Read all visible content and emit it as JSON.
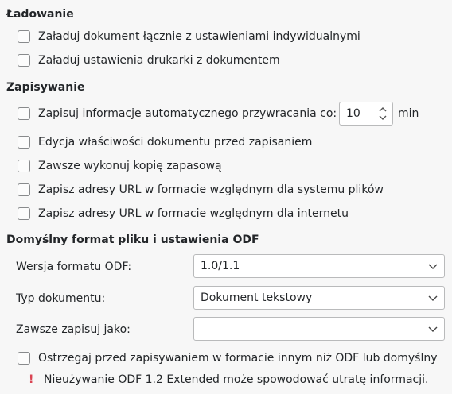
{
  "loading": {
    "title": "Ładowanie",
    "items": [
      {
        "label": "Załaduj dokument łącznie z ustawieniami indywidualnymi",
        "checked": false
      },
      {
        "label": "Załaduj ustawienia drukarki z dokumentem",
        "checked": false
      }
    ]
  },
  "saving": {
    "title": "Zapisywanie",
    "autorecovery": {
      "label": "Zapisuj informacje automatycznego przywracania co:",
      "checked": false,
      "value": "10",
      "unit": "min"
    },
    "items": [
      {
        "label": "Edycja właściwości dokumentu przed zapisaniem",
        "checked": false
      },
      {
        "label": "Zawsze wykonuj kopię zapasową",
        "checked": false
      },
      {
        "label": "Zapisz adresy URL w formacie względnym dla systemu plików",
        "checked": false
      },
      {
        "label": "Zapisz adresy URL w formacie względnym dla internetu",
        "checked": false
      }
    ]
  },
  "odf": {
    "title": "Domyślny format pliku i ustawienia ODF",
    "version_label": "Wersja formatu ODF:",
    "version_value": "1.0/1.1",
    "doctype_label": "Typ dokumentu:",
    "doctype_value": "Dokument tekstowy",
    "saveas_label": "Zawsze zapisuj jako:",
    "saveas_value": "",
    "warn_checkbox": {
      "label": "Ostrzegaj przed zapisywaniem w formacie innym niż ODF lub domyślny",
      "checked": false
    },
    "warning_icon": "exclamation-icon",
    "warning_text": "Nieużywanie ODF 1.2 Extended może spowodować utratę informacji."
  },
  "colors": {
    "background": "#f7f7f7",
    "text": "#232629",
    "warning": "#da4453"
  }
}
